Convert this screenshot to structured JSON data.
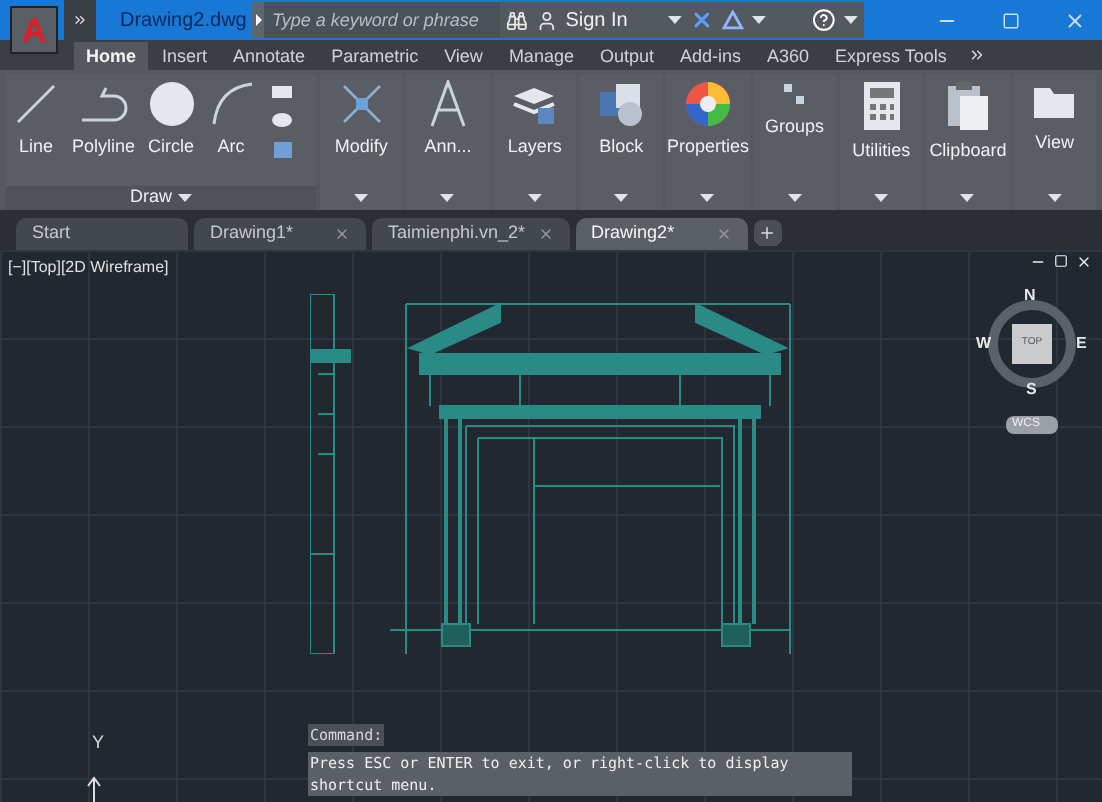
{
  "title_bar": {
    "app_button": "A",
    "file_name": "Drawing2.dwg",
    "search": {
      "placeholder": "Type a keyword or phrase"
    },
    "sign_in": "Sign In"
  },
  "ribbon_tabs": [
    {
      "label": "Home",
      "selected": true
    },
    {
      "label": "Insert",
      "selected": false
    },
    {
      "label": "Annotate",
      "selected": false
    },
    {
      "label": "Parametric",
      "selected": false
    },
    {
      "label": "View",
      "selected": false
    },
    {
      "label": "Manage",
      "selected": false
    },
    {
      "label": "Output",
      "selected": false
    },
    {
      "label": "Add-ins",
      "selected": false
    },
    {
      "label": "A360",
      "selected": false
    },
    {
      "label": "Express Tools",
      "selected": false
    }
  ],
  "draw_panel": {
    "title": "Draw",
    "tools": [
      {
        "label": "Line",
        "kind": "line"
      },
      {
        "label": "Polyline",
        "kind": "polyline"
      },
      {
        "label": "Circle",
        "kind": "circle"
      },
      {
        "label": "Arc",
        "kind": "arc"
      }
    ]
  },
  "panels": [
    {
      "label": "Modify",
      "kind": "modify"
    },
    {
      "label": "Ann...",
      "kind": "annotation"
    },
    {
      "label": "Layers",
      "kind": "layers"
    },
    {
      "label": "Block",
      "kind": "block"
    },
    {
      "label": "Properties",
      "kind": "properties"
    },
    {
      "label": "Groups",
      "kind": "groups"
    },
    {
      "label": "Utilities",
      "kind": "utilities"
    },
    {
      "label": "Clipboard",
      "kind": "clipboard"
    },
    {
      "label": "View",
      "kind": "view"
    }
  ],
  "document_tabs": [
    {
      "label": "Start",
      "selected": false,
      "closable": false
    },
    {
      "label": "Drawing1*",
      "selected": false,
      "closable": true
    },
    {
      "label": "Taimienphi.vn_2*",
      "selected": false,
      "closable": true
    },
    {
      "label": "Drawing2*",
      "selected": true,
      "closable": true
    }
  ],
  "viewport": {
    "label": "[−][Top][2D Wireframe]",
    "viewcube": {
      "north": "N",
      "south": "S",
      "east": "E",
      "west": "W",
      "face": "TOP",
      "coordinate_system": "WCS"
    },
    "ucs_axis": "Y"
  },
  "command_line": {
    "history": "Command:",
    "message": "Press ESC or ENTER to exit, or right-click to display shortcut menu."
  }
}
